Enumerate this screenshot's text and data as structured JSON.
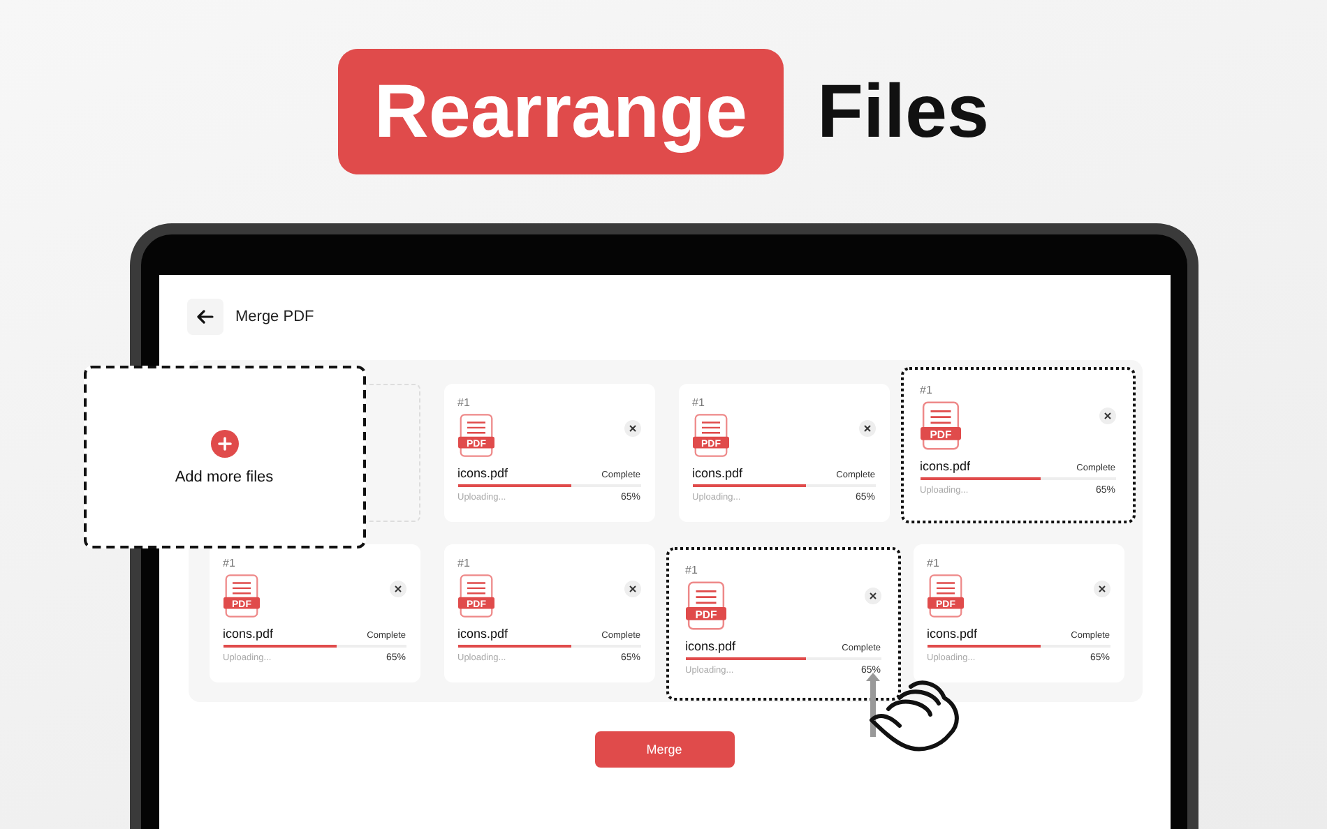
{
  "headline": {
    "highlight": "Rearrange",
    "rest": "Files"
  },
  "screen": {
    "title": "Merge PDF",
    "add_card": {
      "label": "Add more files"
    },
    "files": [
      {
        "kind": "slot"
      },
      {
        "kind": "file",
        "index": "#1",
        "badge": "PDF",
        "name": "icons.pdf",
        "status": "Complete",
        "level": 0.62,
        "caption": "Uploading...",
        "reading": "65%",
        "dragging": false
      },
      {
        "kind": "file",
        "index": "#1",
        "badge": "PDF",
        "name": "icons.pdf",
        "status": "Complete",
        "level": 0.62,
        "caption": "Uploading...",
        "reading": "65%",
        "dragging": false
      },
      {
        "kind": "file",
        "index": "#1",
        "badge": "PDF",
        "name": "icons.pdf",
        "status": "Complete",
        "level": 0.62,
        "caption": "Uploading...",
        "reading": "65%",
        "dragging": true
      },
      {
        "kind": "file",
        "index": "#1",
        "badge": "PDF",
        "name": "icons.pdf",
        "status": "Complete",
        "level": 0.62,
        "caption": "Uploading...",
        "reading": "65%",
        "dragging": false
      },
      {
        "kind": "file",
        "index": "#1",
        "badge": "PDF",
        "name": "icons.pdf",
        "status": "Complete",
        "level": 0.62,
        "caption": "Uploading...",
        "reading": "65%",
        "dragging": false
      },
      {
        "kind": "file",
        "index": "#1",
        "badge": "PDF",
        "name": "icons.pdf",
        "status": "Complete",
        "level": 0.62,
        "caption": "Uploading...",
        "reading": "65%",
        "dragging": true
      },
      {
        "kind": "file",
        "index": "#1",
        "badge": "PDF",
        "name": "icons.pdf",
        "status": "Complete",
        "level": 0.62,
        "caption": "Uploading...",
        "reading": "65%",
        "dragging": false
      }
    ],
    "merge_button": "Merge"
  }
}
